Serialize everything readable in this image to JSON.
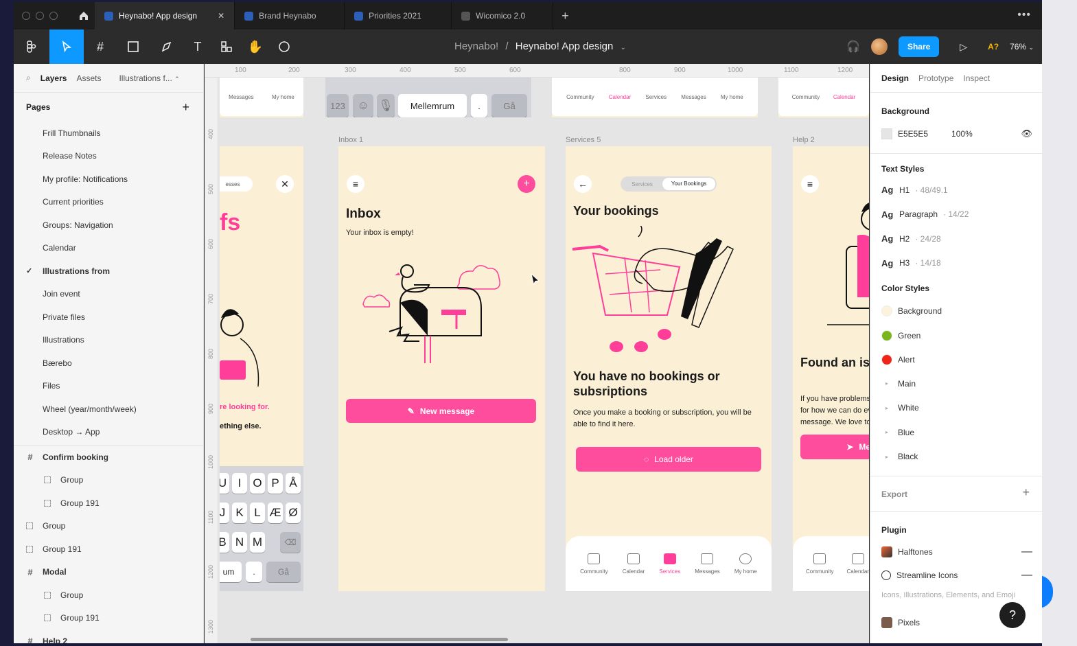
{
  "tabs": [
    {
      "label": "Heynabo! App design",
      "active": true
    },
    {
      "label": "Brand Heynabo",
      "active": false
    },
    {
      "label": "Priorities 2021",
      "active": false
    },
    {
      "label": "Wicomico 2.0",
      "active": false
    }
  ],
  "toolbar": {
    "breadcrumb_project": "Heynabo!",
    "breadcrumb_sep": "/",
    "breadcrumb_file": "Heynabo! App design",
    "share_label": "Share",
    "aq_label": "A?",
    "zoom_label": "76%"
  },
  "left_panel": {
    "tab_layers": "Layers",
    "tab_assets": "Assets",
    "tab_page": "Illustrations f...",
    "pages_title": "Pages",
    "pages": [
      "Frill Thumbnails",
      "Release Notes",
      "My profile: Notifications",
      "Current priorities",
      "Groups: Navigation",
      "Calendar",
      "Illustrations from",
      "Join event",
      "Private files",
      "Illustrations",
      "Bærebo",
      "Files",
      "Wheel (year/month/week)",
      "Desktop → App"
    ],
    "selected_page_index": 6,
    "layers": [
      {
        "label": "Confirm booking",
        "type": "frame",
        "indent": 0
      },
      {
        "label": "Group",
        "type": "group",
        "indent": 1
      },
      {
        "label": "Group 191",
        "type": "group",
        "indent": 1
      },
      {
        "label": "Group",
        "type": "group",
        "indent": 0
      },
      {
        "label": "Group 191",
        "type": "group",
        "indent": 0
      },
      {
        "label": "Modal",
        "type": "frame",
        "indent": 0
      },
      {
        "label": "Group",
        "type": "group",
        "indent": 1
      },
      {
        "label": "Group 191",
        "type": "group",
        "indent": 1
      },
      {
        "label": "Help 2",
        "type": "frame",
        "indent": 0
      }
    ]
  },
  "canvas": {
    "ruler_top": [
      "100",
      "200",
      "300",
      "400",
      "500",
      "600",
      "800",
      "900",
      "1000",
      "1100",
      "1200"
    ],
    "ruler_left": [
      "400",
      "500",
      "600",
      "700",
      "800",
      "900",
      "1000",
      "1100",
      "1200",
      "1300"
    ],
    "frame_labels": {
      "inbox": "Inbox 1",
      "services": "Services 5",
      "help": "Help 2"
    },
    "top_strip": {
      "nav_messages": "Messages",
      "nav_myhome": "My home",
      "kb_123": "123",
      "kb_space": "Mellemrum",
      "kb_dot": ".",
      "kb_go": "Gå",
      "nav_community": "Community",
      "nav_calendar": "Calendar",
      "nav_services": "Services"
    },
    "left_phone": {
      "pill": "esses",
      "big_text": "fs",
      "line1": "re looking for.",
      "line2": "ething else.",
      "row1": [
        "U",
        "I",
        "O",
        "P",
        "Å"
      ],
      "row2": [
        "J",
        "K",
        "L",
        "Æ",
        "Ø"
      ],
      "row3": [
        "B",
        "N",
        "M"
      ],
      "bottom_left": "um",
      "bottom_dot": ".",
      "bottom_go": "Gå"
    },
    "inbox": {
      "title": "Inbox",
      "subtitle": "Your inbox is empty!",
      "button": "New message"
    },
    "services": {
      "toggle_a": "Services",
      "toggle_b": "Your Bookings",
      "title": "Your bookings",
      "empty_title": "You have no bookings or subsriptions",
      "empty_text": "Once you make a booking or subscription, you will be able to find it here.",
      "button": "Load older",
      "nav": [
        {
          "label": "Community",
          "active": false
        },
        {
          "label": "Calendar",
          "active": false
        },
        {
          "label": "Services",
          "active": true
        },
        {
          "label": "Messages",
          "active": false
        },
        {
          "label": "My home",
          "active": false
        }
      ]
    },
    "help": {
      "title": "Found an issu suggestion?",
      "text": "If you have problems wi for how we can do ever message. We love to he",
      "button": "Me",
      "nav_community": "Community",
      "nav_calendar": "Calendar"
    }
  },
  "right_panel": {
    "tab_design": "Design",
    "tab_prototype": "Prototype",
    "tab_inspect": "Inspect",
    "background_title": "Background",
    "bg_hex": "E5E5E5",
    "bg_opacity": "100%",
    "text_styles_title": "Text Styles",
    "text_styles": [
      {
        "name": "H1",
        "spec": "· 48/49.1"
      },
      {
        "name": "Paragraph",
        "spec": "· 14/22"
      },
      {
        "name": "H2",
        "spec": "· 24/28"
      },
      {
        "name": "H3",
        "spec": "· 14/18"
      }
    ],
    "color_styles_title": "Color Styles",
    "color_styles": [
      {
        "name": "Background",
        "color": "#fbf3dc",
        "group": false
      },
      {
        "name": "Green",
        "color": "#7ab51d",
        "group": false
      },
      {
        "name": "Alert",
        "color": "#f0241a",
        "group": false
      },
      {
        "name": "Main",
        "group": true
      },
      {
        "name": "White",
        "group": true
      },
      {
        "name": "Blue",
        "group": true
      },
      {
        "name": "Black",
        "group": true
      }
    ],
    "export_title": "Export",
    "plugin_title": "Plugin",
    "plugins": [
      {
        "name": "Halftones"
      },
      {
        "name": "Streamline Icons"
      }
    ],
    "plugin_desc": "Icons, Illustrations, Elements, and Emoji",
    "plugin_pixels": "Pixels",
    "help_label": "?"
  },
  "colors": {
    "accent": "#0d99ff",
    "brand_pink": "#ff4d9d",
    "canvas_bg": "#e5e5e5",
    "frame_bg": "#fbefd5"
  }
}
